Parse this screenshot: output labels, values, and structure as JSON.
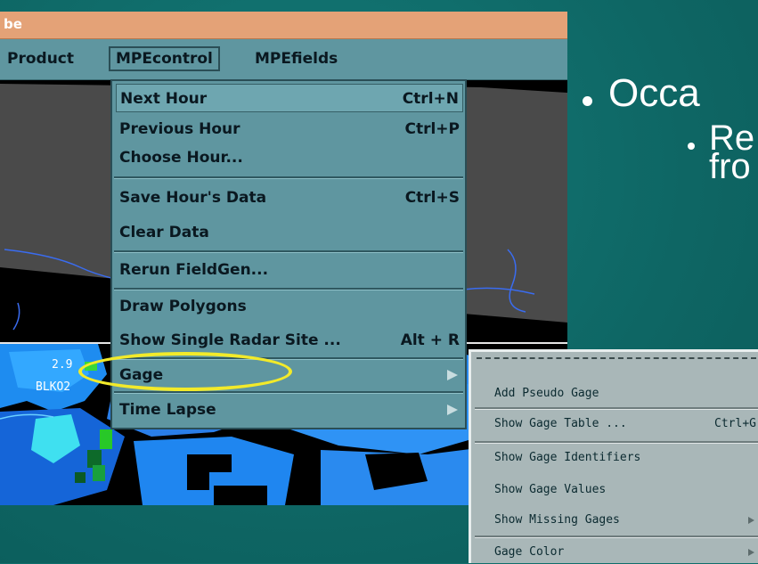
{
  "window": {
    "title": "be",
    "menubar": [
      {
        "label": "Product",
        "mnemonic": "P"
      },
      {
        "label": "MPEcontrol",
        "mnemonic": "M"
      },
      {
        "label": "MPEfields",
        "mnemonic": "E"
      }
    ]
  },
  "mpecontrol_menu": [
    {
      "label": "Next Hour",
      "shortcut": "Ctrl+N"
    },
    {
      "label": "Previous Hour",
      "shortcut": "Ctrl+P"
    },
    {
      "label": "Choose Hour...",
      "shortcut": ""
    },
    {
      "label": "Save Hour's Data",
      "shortcut": "Ctrl+S"
    },
    {
      "label": "Clear Data",
      "shortcut": ""
    },
    {
      "label": "Rerun FieldGen...",
      "shortcut": ""
    },
    {
      "label": "Draw Polygons",
      "shortcut": ""
    },
    {
      "label": "Show Single Radar Site ...",
      "shortcut": "Alt + R"
    },
    {
      "label": "Gage",
      "shortcut": "",
      "submenu": true
    },
    {
      "label": "Time Lapse",
      "shortcut": "",
      "submenu": true
    }
  ],
  "map_labels": {
    "value": "2.9",
    "station": "BLKO2"
  },
  "slide_text": {
    "bullet_1": "Occa",
    "bullet_2_line1": "Re",
    "bullet_2_line2": "fro"
  },
  "gage_submenu": [
    {
      "label": "Add Pseudo Gage",
      "shortcut": ""
    },
    {
      "label": "Show Gage Table ...",
      "shortcut": "Ctrl+G"
    },
    {
      "label": "Show Gage Identifiers",
      "shortcut": ""
    },
    {
      "label": "Show Gage Values",
      "shortcut": ""
    },
    {
      "label": "Show Missing Gages",
      "shortcut": "",
      "submenu": true
    },
    {
      "label": "Gage Color",
      "shortcut": "",
      "submenu": true
    }
  ],
  "colors": {
    "slide_background": "#0f6d6b",
    "title_bar": "#e4a277",
    "menu_background": "#5f96a0",
    "highlight_ellipse": "#f2ea2a",
    "submenu_background": "#a9b7b8"
  }
}
